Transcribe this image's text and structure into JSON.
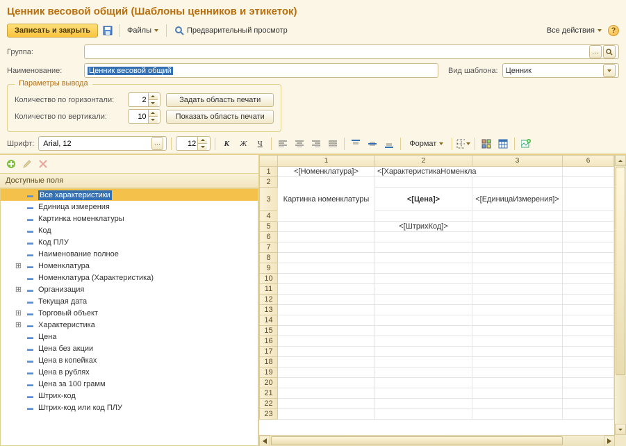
{
  "title": "Ценник весовой общий (Шаблоны ценников и этикеток)",
  "toolbar": {
    "save_close": "Записать и закрыть",
    "files": "Файлы",
    "preview": "Предварительный просмотр",
    "all_actions": "Все действия"
  },
  "form": {
    "group_label": "Группа:",
    "group_value": "",
    "name_label": "Наименование:",
    "name_value": "Ценник весовой общий",
    "template_type_label": "Вид шаблона:",
    "template_type_value": "Ценник"
  },
  "params": {
    "legend": "Параметры вывода",
    "h_label": "Количество по горизонтали:",
    "h_value": "2",
    "v_label": "Количество по вертикали:",
    "v_value": "10",
    "set_area": "Задать область печати",
    "show_area": "Показать область печати"
  },
  "font_tb": {
    "font_label": "Шрифт:",
    "font_value": "Arial, 12",
    "size_value": "12",
    "format": "Формат"
  },
  "tree_header": "Доступные поля",
  "tree": [
    {
      "label": "Все характеристики",
      "expandable": false,
      "selected": true
    },
    {
      "label": "Единица измерения",
      "expandable": false
    },
    {
      "label": "Картинка номенклатуры",
      "expandable": false
    },
    {
      "label": "Код",
      "expandable": false
    },
    {
      "label": "Код ПЛУ",
      "expandable": false
    },
    {
      "label": "Наименование полное",
      "expandable": false
    },
    {
      "label": "Номенклатура",
      "expandable": true
    },
    {
      "label": "Номенклатура (Характеристика)",
      "expandable": false
    },
    {
      "label": "Организация",
      "expandable": true
    },
    {
      "label": "Текущая дата",
      "expandable": false
    },
    {
      "label": "Торговый объект",
      "expandable": true
    },
    {
      "label": "Характеристика",
      "expandable": true
    },
    {
      "label": "Цена",
      "expandable": false
    },
    {
      "label": "Цена без акции",
      "expandable": false
    },
    {
      "label": "Цена в копейках",
      "expandable": false
    },
    {
      "label": "Цена в рублях",
      "expandable": false
    },
    {
      "label": "Цена за 100 грамм",
      "expandable": false
    },
    {
      "label": "Штрих-код",
      "expandable": false
    },
    {
      "label": "Штрих-код или код ПЛУ",
      "expandable": false
    }
  ],
  "grid": {
    "cols": [
      "1",
      "2",
      "3",
      "6"
    ],
    "cells": {
      "r1c1": "<[Номенклатура]>",
      "r1c2": "<[ХарактеристикаНоменкла",
      "r3c1": "Картинка номенклатуры",
      "r3c2": "<[Цена]>",
      "r3c3": "<[ЕдиницаИзмерения]>",
      "r5c2": "<[ШтрихКод]>"
    }
  }
}
